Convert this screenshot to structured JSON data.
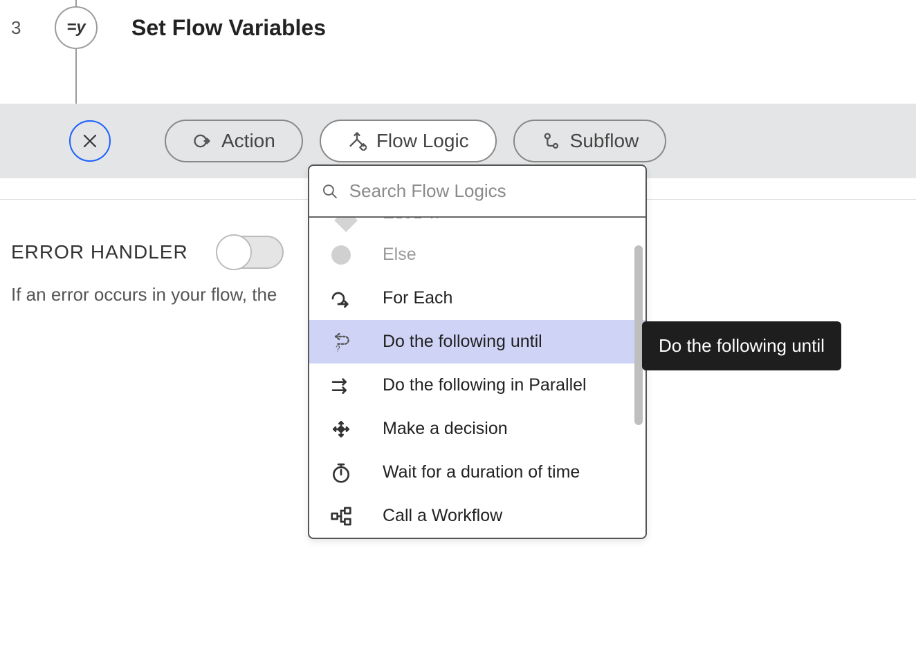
{
  "step": {
    "number": "3",
    "node_symbol": "=y",
    "title": "Set Flow Variables"
  },
  "toolbar": {
    "action_label": "Action",
    "flowlogic_label": "Flow Logic",
    "subflow_label": "Subflow"
  },
  "dropdown": {
    "search_placeholder": "Search Flow Logics",
    "options": {
      "elseif_partial": "Else If",
      "else": "Else",
      "foreach": "For Each",
      "do_until": "Do the following until",
      "parallel": "Do the following in Parallel",
      "decision": "Make a decision",
      "wait": "Wait for a duration of time",
      "workflow": "Call a Workflow"
    }
  },
  "tooltip": {
    "text": "Do the following until"
  },
  "error_handler": {
    "title": "ERROR HANDLER",
    "description": "If an error occurs in your flow, the"
  }
}
